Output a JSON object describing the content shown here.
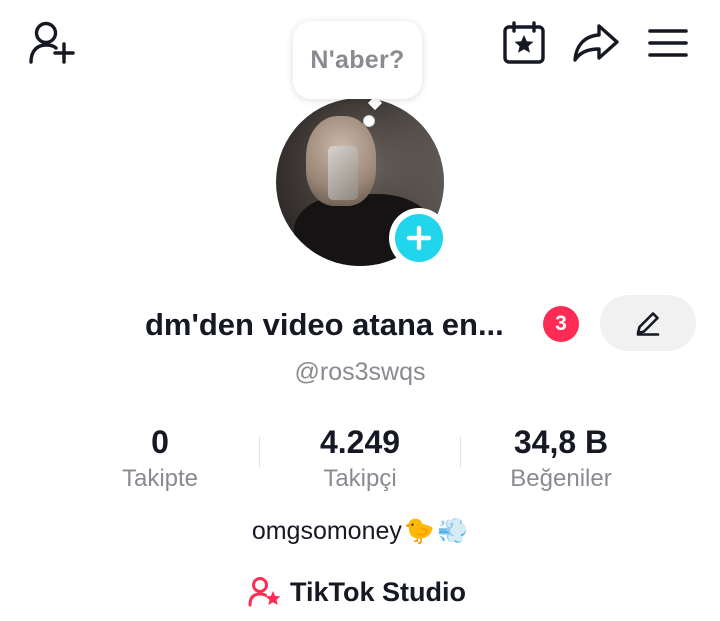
{
  "header": {
    "add_friend_icon": "person-add-icon",
    "calendar_icon": "calendar-star-icon",
    "share_icon": "share-arrow-icon",
    "menu_icon": "hamburger-menu-icon"
  },
  "note_bubble": {
    "text": "N'aber?"
  },
  "profile": {
    "display_name": "dm'den video atana en...",
    "notification_count": "3",
    "username": "@ros3swqs",
    "bio": "omgsomoney",
    "bio_emojis": [
      "🐤",
      "💨"
    ]
  },
  "stats": [
    {
      "value": "0",
      "label": "Takipte"
    },
    {
      "value": "4.249",
      "label": "Takipçi"
    },
    {
      "value": "34,8 B",
      "label": "Beğeniler"
    }
  ],
  "studio": {
    "label": "TikTok Studio",
    "icon": "creator-star-icon"
  },
  "colors": {
    "accent_pink": "#fe2c55",
    "accent_cyan": "#20d5ec",
    "muted_text": "#8a8b91"
  }
}
